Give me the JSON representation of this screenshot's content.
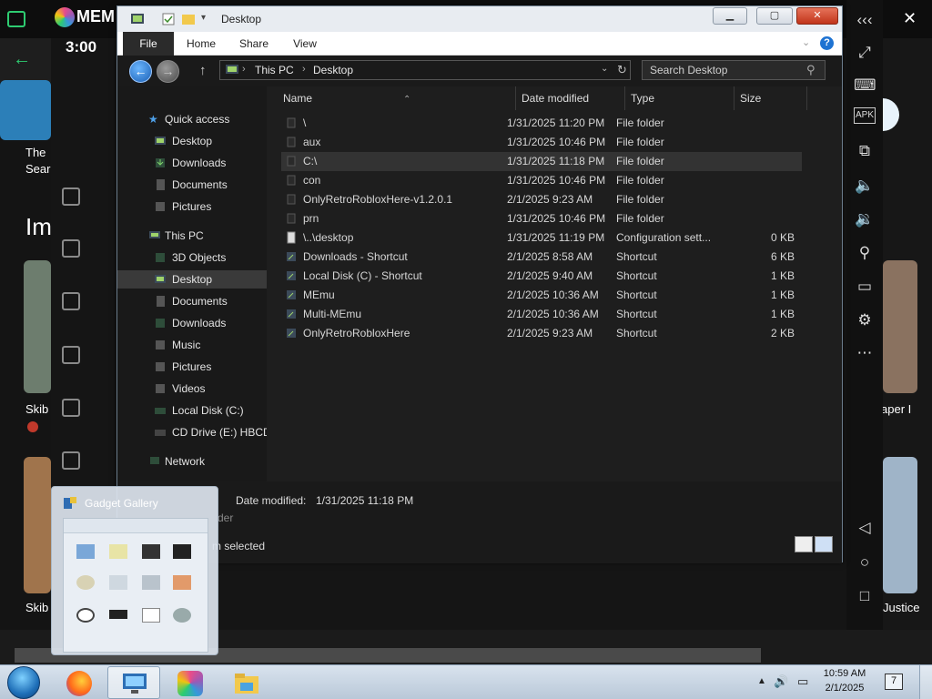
{
  "background_app": {
    "name": "MEM",
    "time": "3:00",
    "left_labels": [
      "The",
      "Sear",
      "Im",
      "Skib",
      "Skib"
    ],
    "right_labels": [
      "aper I",
      "Justice"
    ]
  },
  "explorer": {
    "title": "Desktop",
    "ribbon_tabs": [
      "File",
      "Home",
      "Share",
      "View"
    ],
    "breadcrumb": [
      "This PC",
      "Desktop"
    ],
    "search_placeholder": "Search Desktop",
    "nav": {
      "quick_access": "Quick access",
      "quick_items": [
        "Desktop",
        "Downloads",
        "Documents",
        "Pictures"
      ],
      "this_pc": "This PC",
      "pc_items": [
        "3D Objects",
        "Desktop",
        "Documents",
        "Downloads",
        "Music",
        "Pictures",
        "Videos",
        "Local Disk (C:)",
        "CD Drive (E:) HBCD_"
      ],
      "network": "Network"
    },
    "columns": [
      "Name",
      "Date modified",
      "Type",
      "Size"
    ],
    "files": [
      {
        "name": "\\",
        "date": "1/31/2025 11:20 PM",
        "type": "File folder",
        "size": ""
      },
      {
        "name": "aux",
        "date": "1/31/2025 10:46 PM",
        "type": "File folder",
        "size": ""
      },
      {
        "name": "C:\\",
        "date": "1/31/2025 11:18 PM",
        "type": "File folder",
        "size": ""
      },
      {
        "name": "con",
        "date": "1/31/2025 10:46 PM",
        "type": "File folder",
        "size": ""
      },
      {
        "name": "OnlyRetroRobloxHere-v1.2.0.1",
        "date": "2/1/2025 9:23 AM",
        "type": "File folder",
        "size": ""
      },
      {
        "name": "prn",
        "date": "1/31/2025 10:46 PM",
        "type": "File folder",
        "size": ""
      },
      {
        "name": "\\..\\desktop",
        "date": "1/31/2025 11:19 PM",
        "type": "Configuration sett...",
        "size": "0 KB"
      },
      {
        "name": "Downloads - Shortcut",
        "date": "2/1/2025 8:58 AM",
        "type": "Shortcut",
        "size": "6 KB"
      },
      {
        "name": "Local Disk (C) - Shortcut",
        "date": "2/1/2025 9:40 AM",
        "type": "Shortcut",
        "size": "1 KB"
      },
      {
        "name": "MEmu",
        "date": "2/1/2025 10:36 AM",
        "type": "Shortcut",
        "size": "1 KB"
      },
      {
        "name": "Multi-MEmu",
        "date": "2/1/2025 10:36 AM",
        "type": "Shortcut",
        "size": "1 KB"
      },
      {
        "name": "OnlyRetroRobloxHere",
        "date": "2/1/2025 9:23 AM",
        "type": "Shortcut",
        "size": "2 KB"
      }
    ],
    "selected_index": 2,
    "details": {
      "label": "Date modified:",
      "value": "1/31/2025 11:18 PM",
      "type_fragment": "der",
      "status": "m selected"
    }
  },
  "gadget_gallery": {
    "title": "Gadget Gallery"
  },
  "taskbar": {
    "time": "10:59 AM",
    "date": "2/1/2025",
    "notification_count": "7"
  },
  "colors": {
    "accent_blue": "#1e73d2",
    "selection": "#333333",
    "folder_yellow": "#f2c94c"
  }
}
